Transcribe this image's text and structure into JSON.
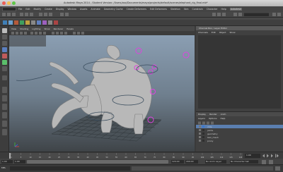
{
  "window": {
    "title": "Autodesk Maya 2014 - Student Version: /Users/zoo/Documents/maya/projects/default/scenes/elephant_rig_final.mb*",
    "traffic_colors": [
      "#ec5f56",
      "#f5bf4f",
      "#5ec748"
    ]
  },
  "menubar": {
    "items": [
      "File",
      "Edit",
      "Modify",
      "Create",
      "Display",
      "Window",
      "Assets",
      "Animate",
      "Geometry Cache",
      "Create Deformers",
      "Edit Deformers",
      "Skeleton",
      "Skin",
      "Constrain",
      "Character",
      "Help"
    ],
    "active_item": "Autodesk"
  },
  "viewport": {
    "menu": [
      "View",
      "Shading",
      "Lighting",
      "Show",
      "Renderer",
      "Panels"
    ]
  },
  "channel_box": {
    "header": "Channel Box / Layer Editor",
    "tabs": [
      "Channels",
      "Edit",
      "Object",
      "Show"
    ]
  },
  "layer_editor": {
    "tabs": [
      "Display",
      "Render",
      "Anim"
    ],
    "menu": [
      "Layers",
      "Options",
      "Help"
    ],
    "layers": [
      {
        "name": "ctrls",
        "color": "#3a78d0",
        "selected": true
      },
      {
        "name": "joints",
        "color": "#2f2f2f",
        "selected": false
      },
      {
        "name": "geometry",
        "color": "#2f2f2f",
        "selected": false
      },
      {
        "name": "Geo_mesh",
        "color": "#2f2f2f",
        "selected": false
      },
      {
        "name": "proxy",
        "color": "#2f2f2f",
        "selected": false
      }
    ]
  },
  "timeline": {
    "ticks": [
      "1",
      "5",
      "10",
      "15",
      "20",
      "25",
      "30",
      "35",
      "40",
      "45",
      "50",
      "55",
      "60",
      "65",
      "70",
      "75",
      "80",
      "85",
      "90",
      "95",
      "100",
      "105",
      "110",
      "115",
      "120"
    ],
    "current_frame": "1.00"
  },
  "range": {
    "start": "1.00",
    "range_start": "1.00",
    "range_end": "120.00",
    "end": "200.00",
    "no_anim_layer": "No Anim Layer",
    "no_char_set": "No Character Set"
  },
  "command_line": {
    "language": "MEL"
  }
}
